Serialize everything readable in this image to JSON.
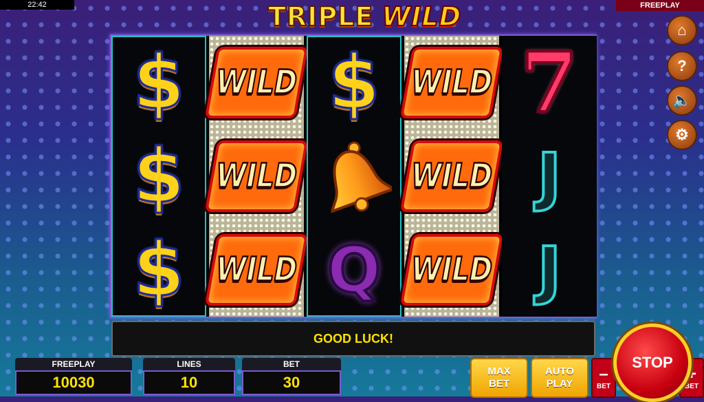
{
  "status_bar": {
    "time": "22:42",
    "mode": "FREEPLAY"
  },
  "logo": {
    "word1": "TRIPLE",
    "word2": "WILD"
  },
  "reels": [
    [
      "dollar",
      "dollar",
      "dollar"
    ],
    [
      "wild",
      "wild",
      "wild"
    ],
    [
      "dollar",
      "bell",
      "Q"
    ],
    [
      "wild",
      "wild",
      "wild"
    ],
    [
      "seven",
      "J",
      "J"
    ]
  ],
  "symbols": {
    "dollar": "$",
    "wild": "WILD",
    "seven": "7",
    "J": "J",
    "Q": "Q"
  },
  "message": "GOOD LUCK!",
  "panels": {
    "credit": {
      "label": "FREEPLAY",
      "value": "10030"
    },
    "lines": {
      "label": "LINES",
      "value": "10"
    },
    "bet": {
      "label": "BET",
      "value": "30"
    }
  },
  "buttons": {
    "max_bet": {
      "line1": "MAX",
      "line2": "BET"
    },
    "auto_play": {
      "line1": "AUTO",
      "line2": "PLAY"
    },
    "minus_bet": {
      "sign": "–",
      "label": "BET"
    },
    "plus_bet": {
      "sign": "+",
      "label": "BET"
    },
    "stop": "STOP"
  },
  "side_menu": [
    "home-icon",
    "help-icon",
    "sound-icon",
    "settings-icon"
  ],
  "side_glyphs": [
    "⌂",
    "?",
    "🔈",
    "⚙"
  ],
  "colors": {
    "accent_yellow": "#ffe300",
    "button_red": "#c40018",
    "frame_purple": "#7a5bd0"
  }
}
